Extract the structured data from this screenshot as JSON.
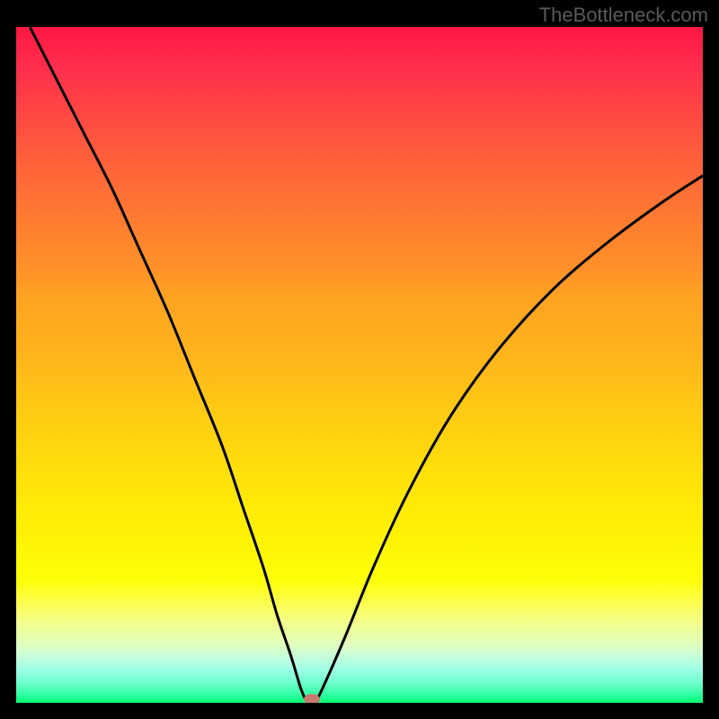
{
  "watermark": "TheBottleneck.com",
  "chart_data": {
    "type": "line",
    "title": "",
    "xlabel": "",
    "ylabel": "",
    "xlim": [
      0,
      100
    ],
    "ylim": [
      0,
      100
    ],
    "grid": false,
    "curve": [
      {
        "x": 2,
        "y": 100
      },
      {
        "x": 6,
        "y": 92
      },
      {
        "x": 10,
        "y": 84
      },
      {
        "x": 14,
        "y": 76
      },
      {
        "x": 18,
        "y": 67
      },
      {
        "x": 22,
        "y": 58
      },
      {
        "x": 26,
        "y": 48
      },
      {
        "x": 30,
        "y": 38
      },
      {
        "x": 33,
        "y": 29
      },
      {
        "x": 36,
        "y": 20
      },
      {
        "x": 38,
        "y": 13
      },
      {
        "x": 40,
        "y": 7
      },
      {
        "x": 41.5,
        "y": 2
      },
      {
        "x": 42.5,
        "y": 0
      },
      {
        "x": 43.5,
        "y": 0
      },
      {
        "x": 45,
        "y": 3
      },
      {
        "x": 48,
        "y": 10
      },
      {
        "x": 52,
        "y": 20
      },
      {
        "x": 57,
        "y": 31
      },
      {
        "x": 63,
        "y": 42
      },
      {
        "x": 70,
        "y": 52
      },
      {
        "x": 78,
        "y": 61
      },
      {
        "x": 86,
        "y": 68
      },
      {
        "x": 94,
        "y": 74
      },
      {
        "x": 100,
        "y": 78
      }
    ],
    "marker": {
      "x": 43,
      "y": 0.5,
      "color": "#c77a6e"
    },
    "gradient_stops": [
      {
        "pos": 0,
        "color": "#ff1744"
      },
      {
        "pos": 50,
        "color": "#ffc316"
      },
      {
        "pos": 82,
        "color": "#ffff0a"
      },
      {
        "pos": 100,
        "color": "#0aff72"
      }
    ]
  }
}
